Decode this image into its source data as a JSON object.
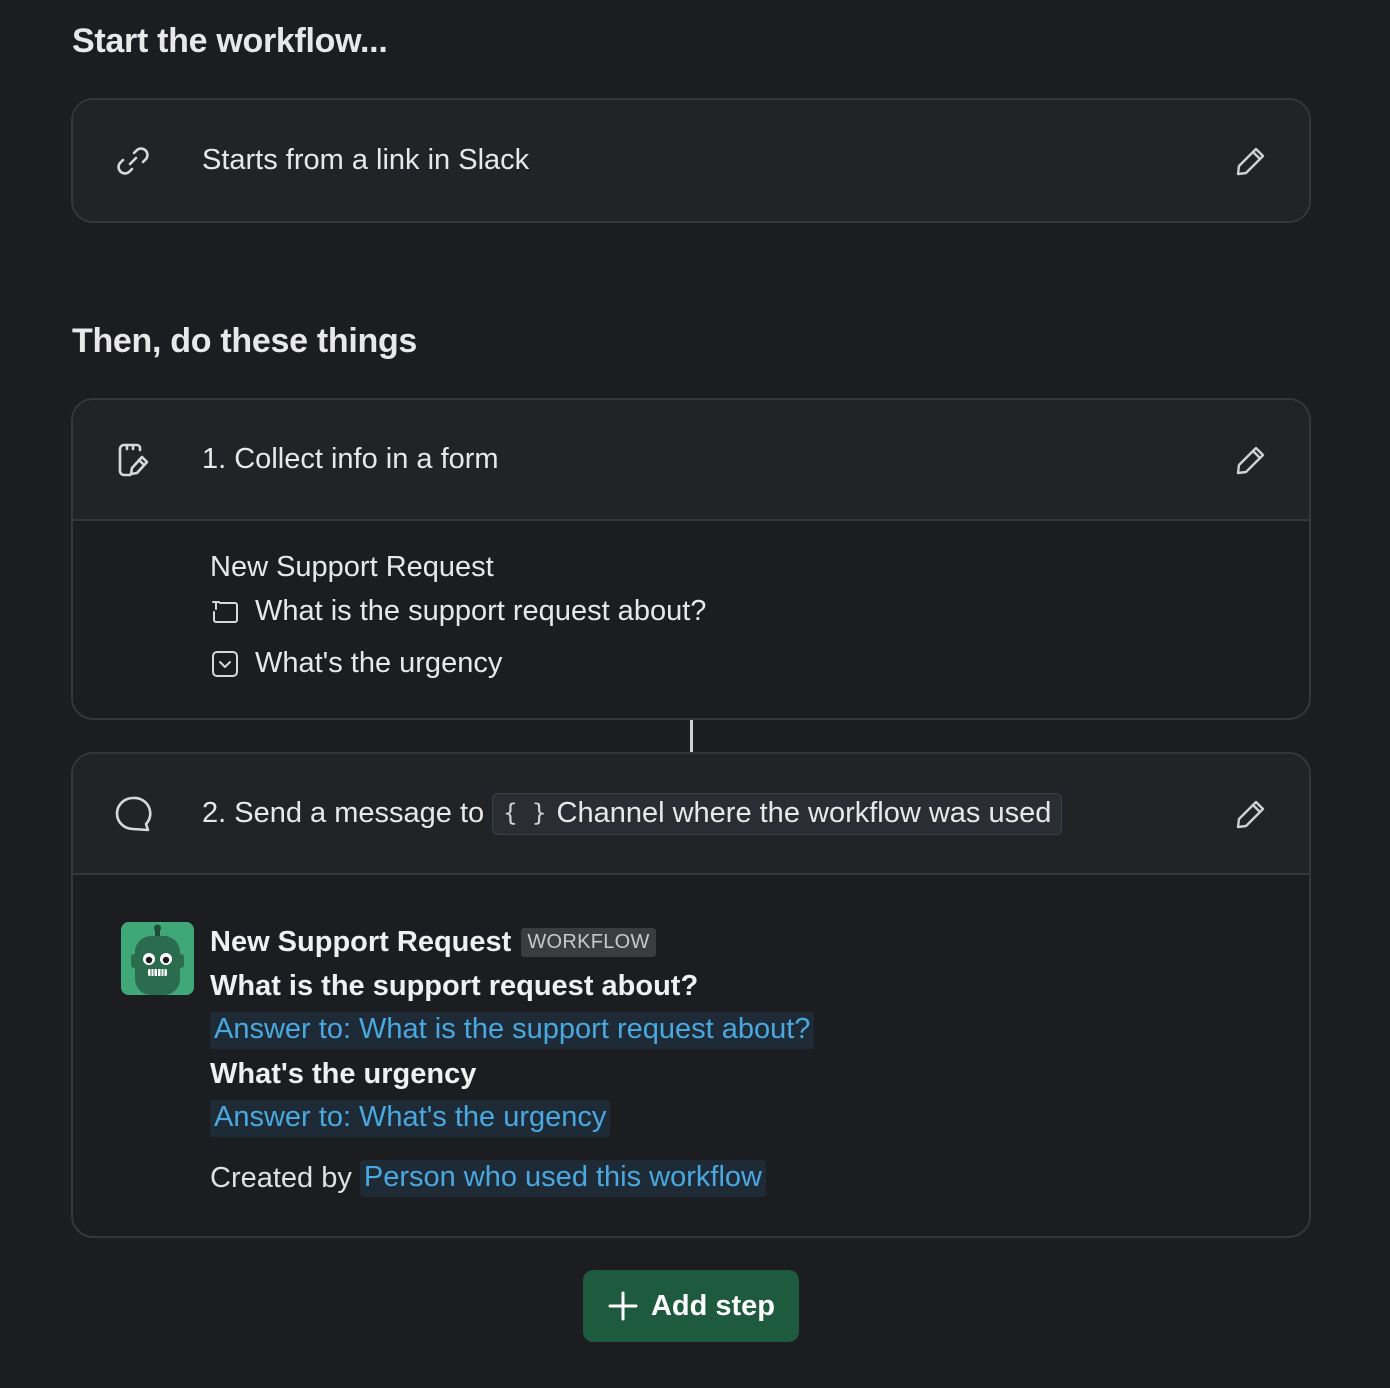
{
  "trigger_section": {
    "title": "Start the workflow...",
    "trigger": {
      "icon": "link-icon",
      "label": "Starts from a link in Slack"
    }
  },
  "steps_section": {
    "title": "Then, do these things",
    "step1": {
      "icon": "form-icon",
      "label": "1. Collect info in a form",
      "form_title": "New Support Request",
      "fields": [
        {
          "icon": "text-field-icon",
          "label": "What is the support request about?"
        },
        {
          "icon": "dropdown-field-icon",
          "label": "What's the urgency"
        }
      ]
    },
    "step2": {
      "icon": "message-icon",
      "label_prefix": "2. Send a message to",
      "channel_token_braces": "{ }",
      "channel_token_label": "Channel where the workflow was used",
      "message": {
        "sender": "New Support Request",
        "badge": "WORKFLOW",
        "question1": "What is the support request about?",
        "answer1": "Answer to: What is the support request about?",
        "question2": "What's the urgency",
        "answer2": "Answer to: What's the urgency",
        "created_by_label": "Created by",
        "created_by_value": "Person who used this workflow"
      }
    }
  },
  "add_step_button": {
    "label": "Add step",
    "icon": "plus-icon"
  },
  "colors": {
    "background": "#1b1d21",
    "card_header": "#212327",
    "border": "#35373b",
    "link_blue": "#4aa8e0",
    "button_green": "#1d5a3e",
    "avatar_green": "#3fa876"
  }
}
